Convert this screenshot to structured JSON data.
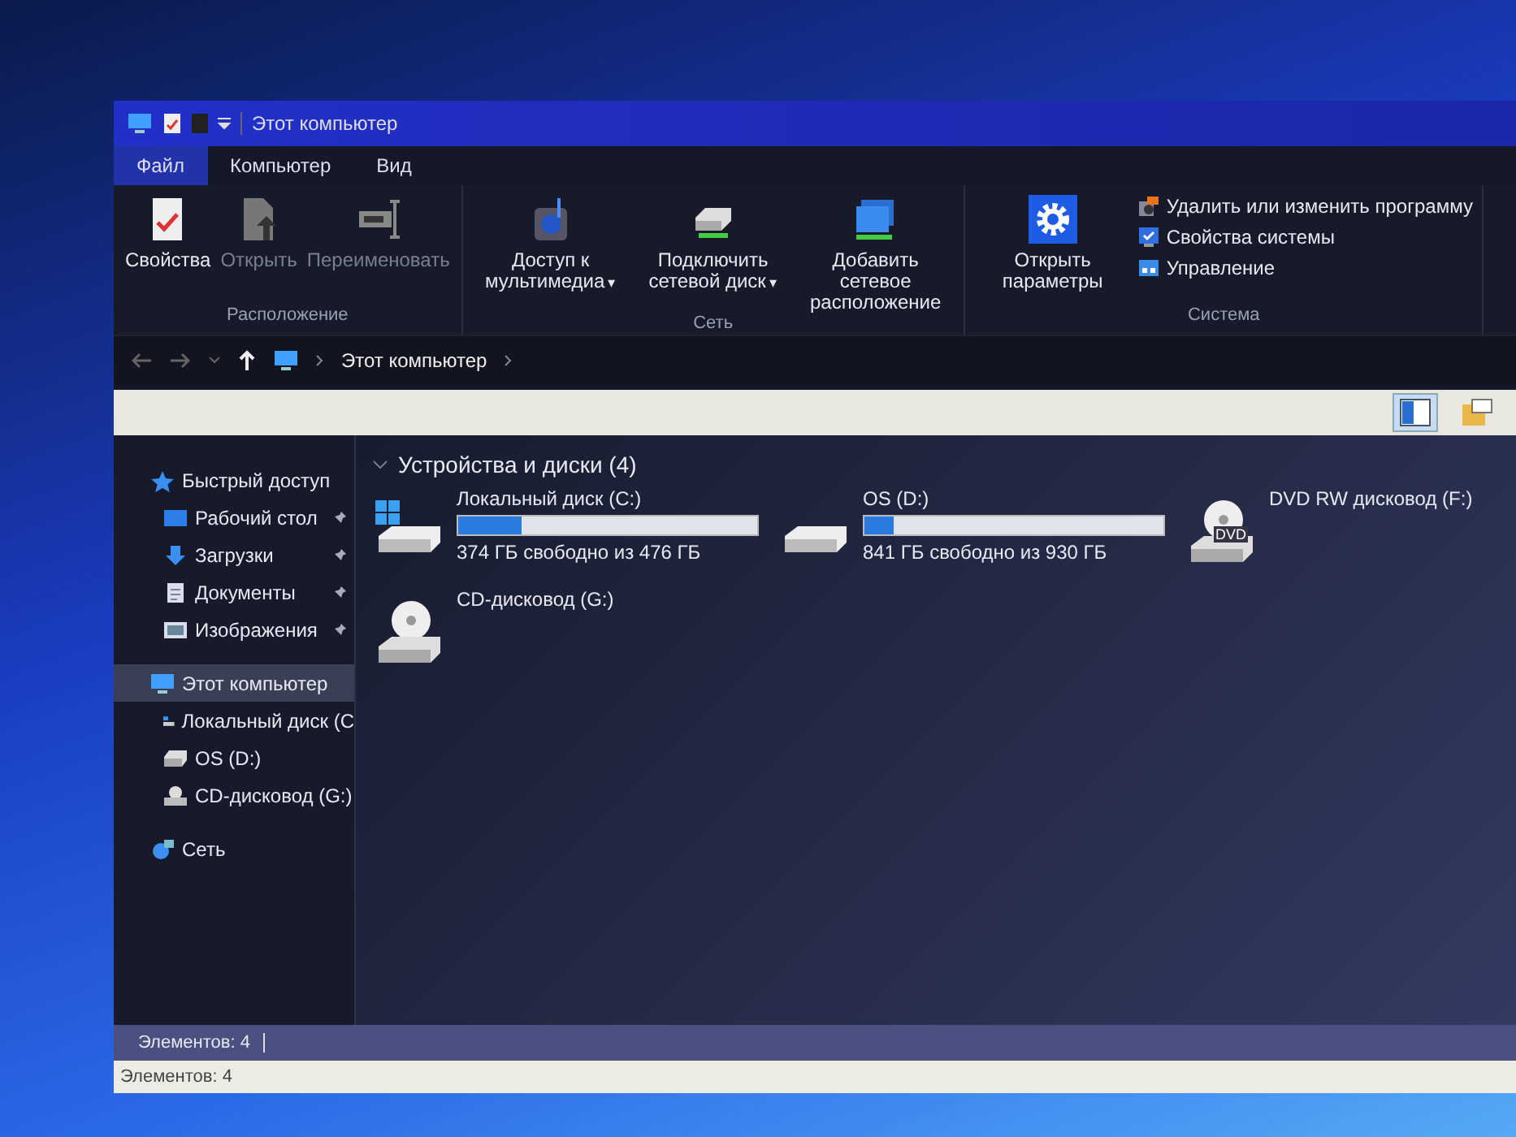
{
  "window": {
    "title": "Этот компьютер"
  },
  "menu_tabs": [
    {
      "label": "Файл",
      "selected": true
    },
    {
      "label": "Компьютер",
      "selected": false
    },
    {
      "label": "Вид",
      "selected": false
    }
  ],
  "ribbon": {
    "groups": [
      {
        "label": "Расположение",
        "items": [
          {
            "kind": "large",
            "label": "Свойства",
            "disabled": false
          },
          {
            "kind": "large",
            "label": "Открыть",
            "disabled": true
          },
          {
            "kind": "large",
            "label": "Переименовать",
            "disabled": true
          }
        ]
      },
      {
        "label": "Сеть",
        "items": [
          {
            "kind": "large",
            "label": "Доступ к мультимедиа",
            "disabled": false,
            "caret": "▾"
          },
          {
            "kind": "large",
            "label": "Подключить сетевой диск",
            "disabled": false,
            "caret": "▾"
          },
          {
            "kind": "large",
            "label": "Добавить сетевое расположение",
            "disabled": false
          }
        ]
      },
      {
        "label": "Система",
        "items": [
          {
            "kind": "large",
            "label": "Открыть параметры",
            "disabled": false
          },
          {
            "kind": "small",
            "label": "Удалить или изменить программу",
            "disabled": false
          },
          {
            "kind": "small",
            "label": "Свойства системы",
            "disabled": false
          },
          {
            "kind": "small",
            "label": "Управление",
            "disabled": false
          }
        ]
      }
    ]
  },
  "address_bar": {
    "path": [
      "Этот компьютер"
    ]
  },
  "view_buttons": [
    {
      "selected": true
    },
    {
      "selected": false
    }
  ],
  "sidebar": {
    "items": [
      {
        "label": "Быстрый доступ",
        "selected": false,
        "children": [
          {
            "label": "Рабочий стол",
            "pinned": true,
            "selected": false
          },
          {
            "label": "Загрузки",
            "pinned": true,
            "selected": false
          },
          {
            "label": "Документы",
            "pinned": true,
            "selected": false
          },
          {
            "label": "Изображения",
            "pinned": true,
            "selected": false
          }
        ]
      },
      {
        "label": "Этот компьютер",
        "selected": true,
        "children": [
          {
            "label": "Локальный диск (С",
            "pinned": false,
            "selected": false
          },
          {
            "label": "OS (D:)",
            "pinned": false,
            "selected": false
          },
          {
            "label": "CD-дисковод (G:)",
            "pinned": false,
            "selected": false
          }
        ]
      },
      {
        "label": "Сеть",
        "selected": false
      }
    ]
  },
  "content": {
    "section_title": "Устройства и диски (4)",
    "drives": [
      {
        "kind": "disk",
        "name": "Локальный диск (C:)",
        "level": 0.21,
        "space": "374 ГБ свободно из 476 ГБ"
      },
      {
        "kind": "disk",
        "name": "OS (D:)",
        "level": 0.1,
        "space": "841 ГБ свободно из 930 ГБ"
      },
      {
        "kind": "optical",
        "name": "DVD RW дисковод (F:)",
        "label": "DVD"
      },
      {
        "kind": "optical",
        "name": "CD-дисковод (G:)"
      }
    ]
  },
  "status_bar": {
    "text": "Элементов: 4"
  },
  "details_bar": {
    "text": "Элементов: 4"
  }
}
